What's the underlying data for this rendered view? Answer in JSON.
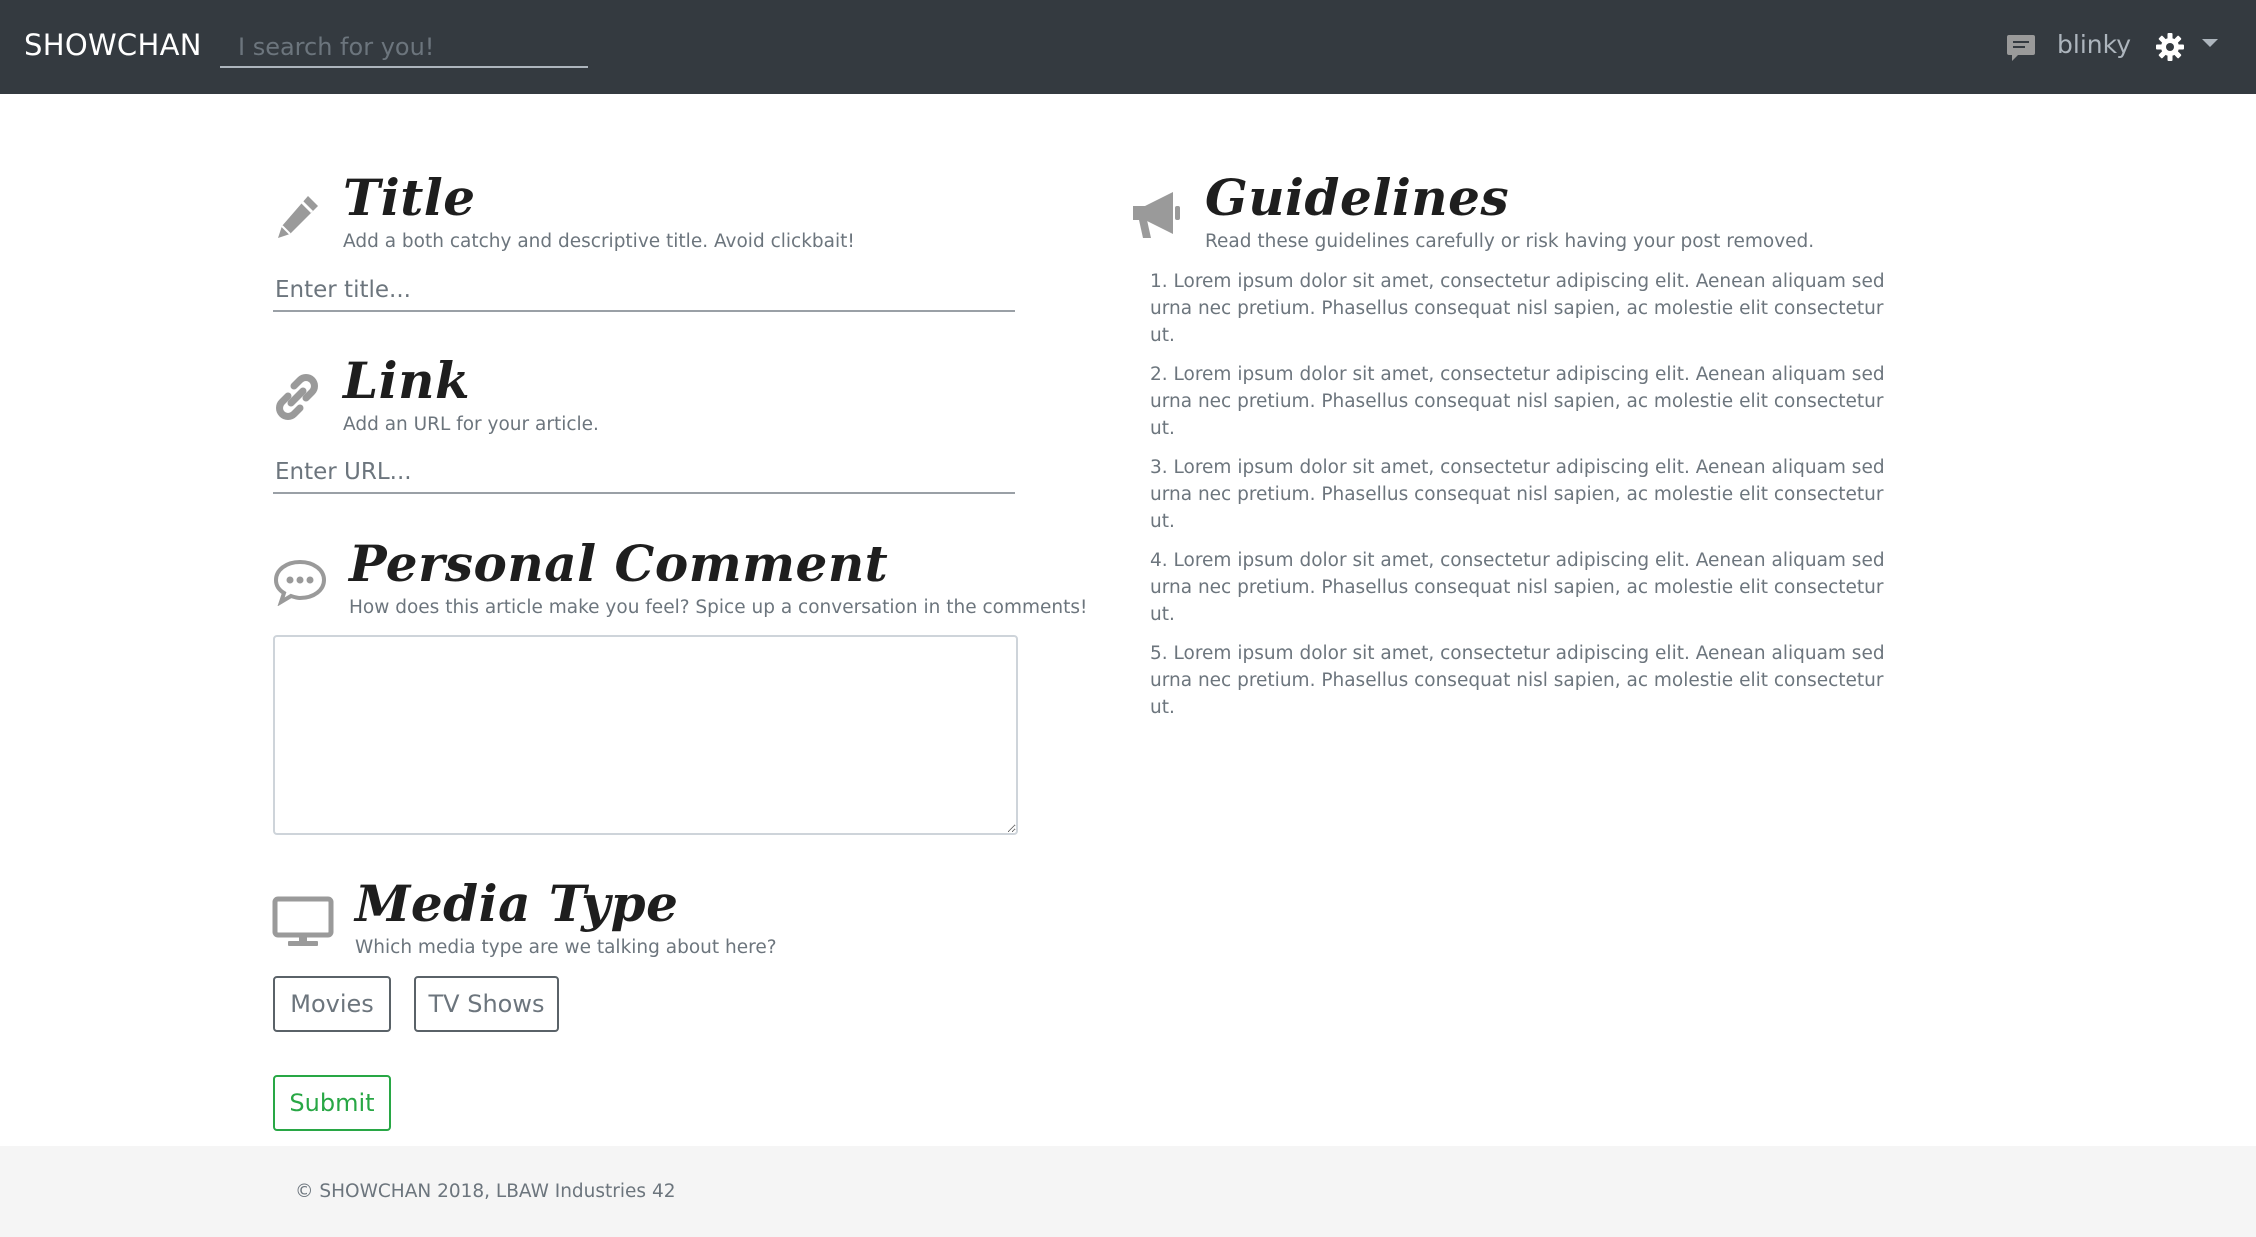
{
  "navbar": {
    "brand": "SHOWCHAN",
    "search_placeholder": "I search for you!",
    "username": "blinky"
  },
  "form": {
    "title_section": {
      "heading": "Title",
      "subtitle": "Add a both catchy and descriptive title. Avoid clickbait!",
      "placeholder": "Enter title..."
    },
    "link_section": {
      "heading": "Link",
      "subtitle": "Add an URL for your article.",
      "placeholder": "Enter URL..."
    },
    "comment_section": {
      "heading": "Personal Comment",
      "subtitle": "How does this article make you feel? Spice up a conversation in the comments!"
    },
    "media_section": {
      "heading": "Media Type",
      "subtitle": "Which media type are we talking about here?",
      "options": [
        "Movies",
        "TV Shows"
      ]
    },
    "submit_label": "Submit"
  },
  "guidelines": {
    "heading": "Guidelines",
    "subtitle": "Read these guidelines carefully or risk having your post removed.",
    "items": [
      "1. Lorem ipsum dolor sit amet, consectetur adipiscing elit. Aenean aliquam sed urna nec pretium. Phasellus consequat nisl sapien, ac molestie elit consectetur ut.",
      "2. Lorem ipsum dolor sit amet, consectetur adipiscing elit. Aenean aliquam sed urna nec pretium. Phasellus consequat nisl sapien, ac molestie elit consectetur ut.",
      "3. Lorem ipsum dolor sit amet, consectetur adipiscing elit. Aenean aliquam sed urna nec pretium. Phasellus consequat nisl sapien, ac molestie elit consectetur ut.",
      "4. Lorem ipsum dolor sit amet, consectetur adipiscing elit. Aenean aliquam sed urna nec pretium. Phasellus consequat nisl sapien, ac molestie elit consectetur ut.",
      "5. Lorem ipsum dolor sit amet, consectetur adipiscing elit. Aenean aliquam sed urna nec pretium. Phasellus consequat nisl sapien, ac molestie elit consectetur ut."
    ]
  },
  "footer": {
    "copyright": "© SHOWCHAN 2018, LBAW Industries 42"
  },
  "icons": {
    "title": "pencil-icon",
    "link": "link-icon",
    "comment": "comment-dots-icon",
    "media": "monitor-icon",
    "guidelines": "megaphone-icon",
    "chat": "chat-icon",
    "settings": "gear-icon"
  },
  "colors": {
    "navbar_bg": "#343a40",
    "submit_accent": "#28a745",
    "footer_bg": "#f5f5f5",
    "icon_gray": "#9a9a9a"
  }
}
